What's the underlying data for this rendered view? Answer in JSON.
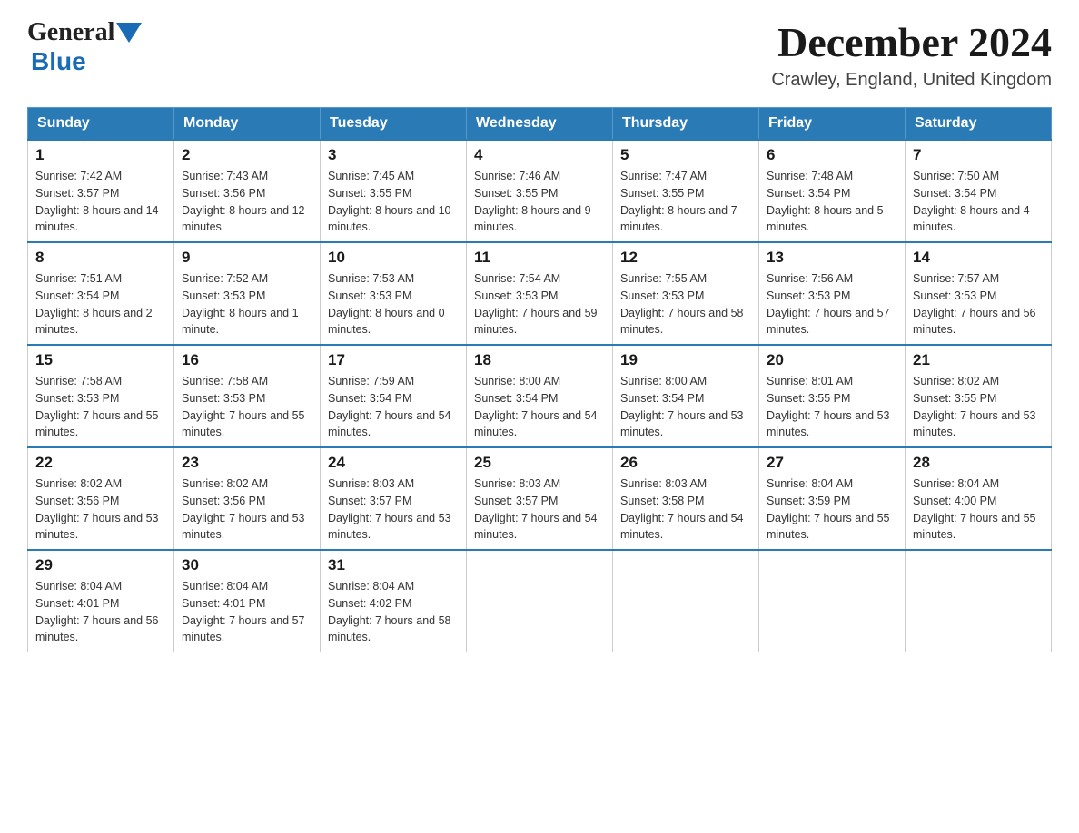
{
  "logo": {
    "general": "General",
    "blue": "Blue"
  },
  "title": "December 2024",
  "subtitle": "Crawley, England, United Kingdom",
  "days_of_week": [
    "Sunday",
    "Monday",
    "Tuesday",
    "Wednesday",
    "Thursday",
    "Friday",
    "Saturday"
  ],
  "weeks": [
    [
      {
        "day": 1,
        "sunrise": "7:42 AM",
        "sunset": "3:57 PM",
        "daylight": "8 hours and 14 minutes."
      },
      {
        "day": 2,
        "sunrise": "7:43 AM",
        "sunset": "3:56 PM",
        "daylight": "8 hours and 12 minutes."
      },
      {
        "day": 3,
        "sunrise": "7:45 AM",
        "sunset": "3:55 PM",
        "daylight": "8 hours and 10 minutes."
      },
      {
        "day": 4,
        "sunrise": "7:46 AM",
        "sunset": "3:55 PM",
        "daylight": "8 hours and 9 minutes."
      },
      {
        "day": 5,
        "sunrise": "7:47 AM",
        "sunset": "3:55 PM",
        "daylight": "8 hours and 7 minutes."
      },
      {
        "day": 6,
        "sunrise": "7:48 AM",
        "sunset": "3:54 PM",
        "daylight": "8 hours and 5 minutes."
      },
      {
        "day": 7,
        "sunrise": "7:50 AM",
        "sunset": "3:54 PM",
        "daylight": "8 hours and 4 minutes."
      }
    ],
    [
      {
        "day": 8,
        "sunrise": "7:51 AM",
        "sunset": "3:54 PM",
        "daylight": "8 hours and 2 minutes."
      },
      {
        "day": 9,
        "sunrise": "7:52 AM",
        "sunset": "3:53 PM",
        "daylight": "8 hours and 1 minute."
      },
      {
        "day": 10,
        "sunrise": "7:53 AM",
        "sunset": "3:53 PM",
        "daylight": "8 hours and 0 minutes."
      },
      {
        "day": 11,
        "sunrise": "7:54 AM",
        "sunset": "3:53 PM",
        "daylight": "7 hours and 59 minutes."
      },
      {
        "day": 12,
        "sunrise": "7:55 AM",
        "sunset": "3:53 PM",
        "daylight": "7 hours and 58 minutes."
      },
      {
        "day": 13,
        "sunrise": "7:56 AM",
        "sunset": "3:53 PM",
        "daylight": "7 hours and 57 minutes."
      },
      {
        "day": 14,
        "sunrise": "7:57 AM",
        "sunset": "3:53 PM",
        "daylight": "7 hours and 56 minutes."
      }
    ],
    [
      {
        "day": 15,
        "sunrise": "7:58 AM",
        "sunset": "3:53 PM",
        "daylight": "7 hours and 55 minutes."
      },
      {
        "day": 16,
        "sunrise": "7:58 AM",
        "sunset": "3:53 PM",
        "daylight": "7 hours and 55 minutes."
      },
      {
        "day": 17,
        "sunrise": "7:59 AM",
        "sunset": "3:54 PM",
        "daylight": "7 hours and 54 minutes."
      },
      {
        "day": 18,
        "sunrise": "8:00 AM",
        "sunset": "3:54 PM",
        "daylight": "7 hours and 54 minutes."
      },
      {
        "day": 19,
        "sunrise": "8:00 AM",
        "sunset": "3:54 PM",
        "daylight": "7 hours and 53 minutes."
      },
      {
        "day": 20,
        "sunrise": "8:01 AM",
        "sunset": "3:55 PM",
        "daylight": "7 hours and 53 minutes."
      },
      {
        "day": 21,
        "sunrise": "8:02 AM",
        "sunset": "3:55 PM",
        "daylight": "7 hours and 53 minutes."
      }
    ],
    [
      {
        "day": 22,
        "sunrise": "8:02 AM",
        "sunset": "3:56 PM",
        "daylight": "7 hours and 53 minutes."
      },
      {
        "day": 23,
        "sunrise": "8:02 AM",
        "sunset": "3:56 PM",
        "daylight": "7 hours and 53 minutes."
      },
      {
        "day": 24,
        "sunrise": "8:03 AM",
        "sunset": "3:57 PM",
        "daylight": "7 hours and 53 minutes."
      },
      {
        "day": 25,
        "sunrise": "8:03 AM",
        "sunset": "3:57 PM",
        "daylight": "7 hours and 54 minutes."
      },
      {
        "day": 26,
        "sunrise": "8:03 AM",
        "sunset": "3:58 PM",
        "daylight": "7 hours and 54 minutes."
      },
      {
        "day": 27,
        "sunrise": "8:04 AM",
        "sunset": "3:59 PM",
        "daylight": "7 hours and 55 minutes."
      },
      {
        "day": 28,
        "sunrise": "8:04 AM",
        "sunset": "4:00 PM",
        "daylight": "7 hours and 55 minutes."
      }
    ],
    [
      {
        "day": 29,
        "sunrise": "8:04 AM",
        "sunset": "4:01 PM",
        "daylight": "7 hours and 56 minutes."
      },
      {
        "day": 30,
        "sunrise": "8:04 AM",
        "sunset": "4:01 PM",
        "daylight": "7 hours and 57 minutes."
      },
      {
        "day": 31,
        "sunrise": "8:04 AM",
        "sunset": "4:02 PM",
        "daylight": "7 hours and 58 minutes."
      },
      null,
      null,
      null,
      null
    ]
  ]
}
